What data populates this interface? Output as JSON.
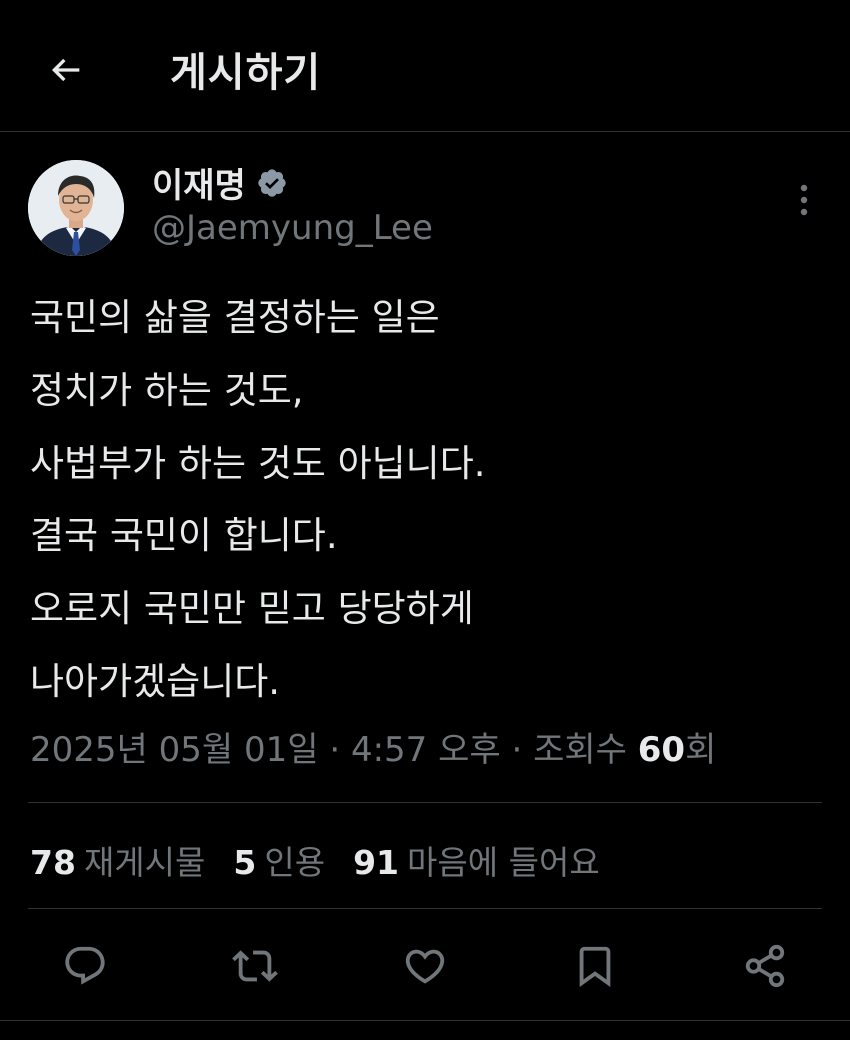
{
  "header": {
    "title": "게시하기",
    "back_icon": "arrow-left-icon"
  },
  "author": {
    "name": "이재명",
    "handle": "@Jaemyung_Lee",
    "verified": true,
    "verified_color": "#8b98a5"
  },
  "tweet": {
    "lines": [
      "국민의 삶을 결정하는 일은",
      "정치가 하는 것도,",
      "사법부가 하는 것도 아닙니다.",
      "결국 국민이 합니다.",
      "오로지 국민만 믿고 당당하게",
      "나아가겠습니다."
    ]
  },
  "meta": {
    "date": "2025년 05월 01일",
    "separator": " · ",
    "time": "4:57 오후",
    "views_label": "조회수",
    "views_count": "60",
    "views_suffix": "회"
  },
  "stats": {
    "reposts_count": "78",
    "reposts_label": "재게시물",
    "quotes_count": "5",
    "quotes_label": "인용",
    "likes_count": "91",
    "likes_label": "마음에 들어요"
  },
  "actions": [
    {
      "name": "reply-button",
      "icon": "speech-bubble-icon"
    },
    {
      "name": "repost-button",
      "icon": "repost-arrows-icon"
    },
    {
      "name": "like-button",
      "icon": "heart-icon"
    },
    {
      "name": "bookmark-button",
      "icon": "bookmark-icon"
    },
    {
      "name": "share-button",
      "icon": "share-nodes-icon"
    }
  ],
  "colors": {
    "background": "#000000",
    "primary_text": "#e7e9ea",
    "secondary_text": "#71767b",
    "divider": "#2f3336"
  }
}
